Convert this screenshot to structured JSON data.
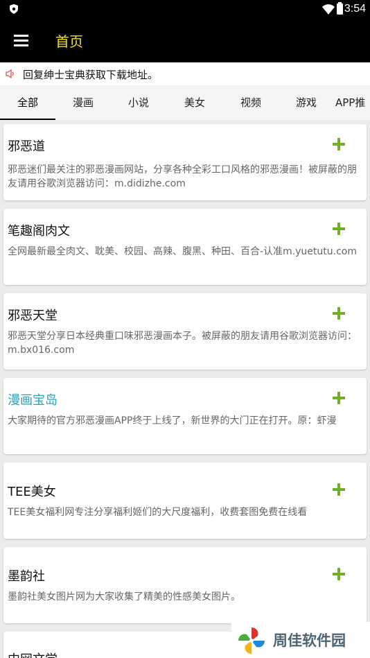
{
  "status_bar": {
    "time": "3:54"
  },
  "app_bar": {
    "title": "首页",
    "menu_icon": "hamburger-menu-icon"
  },
  "notice": {
    "icon": "speaker-icon",
    "text": "回复绅士宝典获取下载地址。"
  },
  "tabs": [
    {
      "label": "全部",
      "active": true
    },
    {
      "label": "漫画"
    },
    {
      "label": "小说"
    },
    {
      "label": "美女"
    },
    {
      "label": "视频"
    },
    {
      "label": "游戏"
    },
    {
      "label": "APP推"
    }
  ],
  "cards": [
    {
      "name": "邪恶道",
      "description": "邪恶迷们最关注的邪恶漫画网站，分享各种全彩工口风格的邪恶漫画！被屏蔽的朋友请用谷歌浏览器访问：m.didizhe.com"
    },
    {
      "name": "笔趣阁肉文",
      "description": "全网最新最全肉文、耽美、校园、高辣、腹黑、种田、百合-认准m.yuetutu.com"
    },
    {
      "name": "邪恶天堂",
      "description": "邪恶天堂分享日本经典重口味邪恶漫画本子。被屏蔽的朋友请用谷歌浏览器访问：m.bx016.com"
    },
    {
      "name": "漫画宝岛",
      "description": "大家期待的官方邪恶漫画APP终于上线了，新世界的大门正在打开。原：虾漫",
      "highlight_color": "#2f9fb5"
    },
    {
      "name": "TEE美女",
      "description": "TEE美女福利网专注分享福利姬们的大尺度福利，收费套图免费在线看"
    },
    {
      "name": "墨韵社",
      "description": "墨韵社美女图片网为大家收集了精美的性感美女图片。"
    },
    {
      "name": "中网文学",
      "description": ""
    }
  ],
  "colors": {
    "title_yellow": "#f7e300",
    "plus_green": "#6fae27",
    "appbar_bg": "#000000"
  },
  "watermark": {
    "text": "周佳软件园"
  }
}
